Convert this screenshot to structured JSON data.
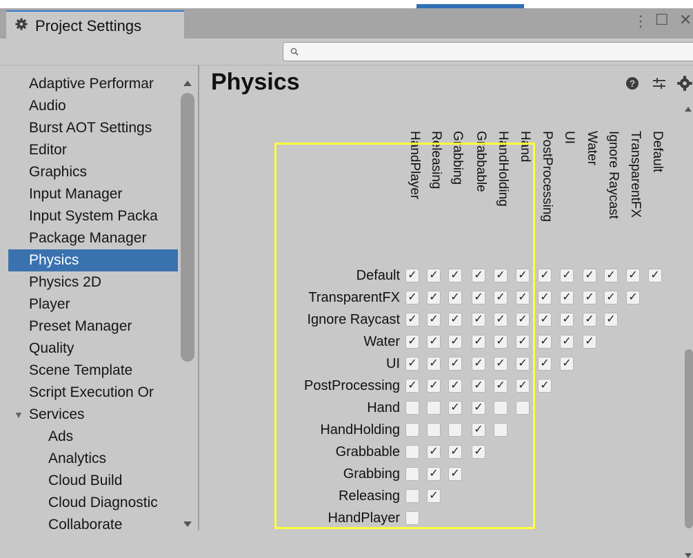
{
  "window": {
    "tab_title": "Project Settings",
    "controls": [
      "⋮",
      "☐",
      "✕"
    ]
  },
  "search": {
    "value": "",
    "placeholder": ""
  },
  "sidebar": {
    "items": [
      {
        "label": "Adaptive Performar",
        "level": 0
      },
      {
        "label": "Audio",
        "level": 0
      },
      {
        "label": "Burst AOT Settings",
        "level": 0
      },
      {
        "label": "Editor",
        "level": 0
      },
      {
        "label": "Graphics",
        "level": 0
      },
      {
        "label": "Input Manager",
        "level": 0
      },
      {
        "label": "Input System Packa",
        "level": 0
      },
      {
        "label": "Package Manager",
        "level": 0
      },
      {
        "label": "Physics",
        "level": 0,
        "selected": true
      },
      {
        "label": "Physics 2D",
        "level": 0
      },
      {
        "label": "Player",
        "level": 0
      },
      {
        "label": "Preset Manager",
        "level": 0
      },
      {
        "label": "Quality",
        "level": 0
      },
      {
        "label": "Scene Template",
        "level": 0
      },
      {
        "label": "Script Execution Or",
        "level": 0
      },
      {
        "label": "Services",
        "level": 0,
        "expanded": true
      },
      {
        "label": "Ads",
        "level": 1
      },
      {
        "label": "Analytics",
        "level": 1
      },
      {
        "label": "Cloud Build",
        "level": 1
      },
      {
        "label": "Cloud Diagnostic",
        "level": 1
      },
      {
        "label": "Collaborate",
        "level": 1
      }
    ]
  },
  "main": {
    "title": "Physics",
    "header_icons": [
      "help-icon",
      "preset-icon",
      "settings-icon"
    ]
  },
  "matrix": {
    "layers": [
      "Default",
      "TransparentFX",
      "Ignore Raycast",
      "Water",
      "UI",
      "PostProcessing",
      "Hand",
      "HandHolding",
      "Grabbable",
      "Grabbing",
      "Releasing",
      "HandPlayer"
    ],
    "columns": [
      "HandPlayer",
      "Releasing",
      "Grabbing",
      "Grabbable",
      "HandHolding",
      "Hand",
      "PostProcessing",
      "UI",
      "Water",
      "Ignore Raycast",
      "TransparentFX",
      "Default"
    ],
    "rows": [
      [
        true,
        true,
        true,
        true,
        true,
        true,
        true,
        true,
        true,
        true,
        true,
        true
      ],
      [
        true,
        true,
        true,
        true,
        true,
        true,
        true,
        true,
        true,
        true,
        true
      ],
      [
        true,
        true,
        true,
        true,
        true,
        true,
        true,
        true,
        true,
        true
      ],
      [
        true,
        true,
        true,
        true,
        true,
        true,
        true,
        true,
        true
      ],
      [
        true,
        true,
        true,
        true,
        true,
        true,
        true,
        true
      ],
      [
        true,
        true,
        true,
        true,
        true,
        true,
        true
      ],
      [
        false,
        false,
        true,
        true,
        false,
        false
      ],
      [
        false,
        false,
        false,
        true,
        false
      ],
      [
        false,
        true,
        true,
        true
      ],
      [
        false,
        true,
        true
      ],
      [
        false,
        true
      ],
      [
        false
      ]
    ]
  },
  "colors": {
    "selection": "#3a72b0",
    "highlight_box": "#ffff3a",
    "tab_accent": "#3a79d6"
  }
}
